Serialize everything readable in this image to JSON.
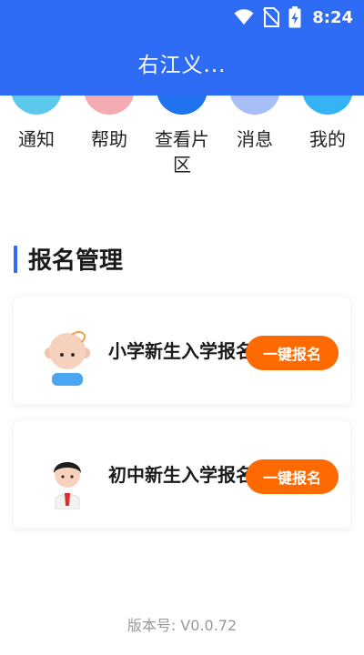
{
  "status_bar": {
    "time": "8:24",
    "icons": [
      "wifi-icon",
      "no-sim-icon",
      "battery-charging-icon"
    ]
  },
  "header": {
    "title": "右江义..."
  },
  "quick_nav": [
    {
      "label": "通知",
      "icon": "notice-icon",
      "color": "#5cc8ee"
    },
    {
      "label": "帮助",
      "icon": "help-icon",
      "color": "#f6aab2"
    },
    {
      "label": "查看片区",
      "icon": "area-icon",
      "color": "#1f73f0"
    },
    {
      "label": "消息",
      "icon": "message-icon",
      "color": "#a9bdf7"
    },
    {
      "label": "我的",
      "icon": "profile-icon",
      "color": "#35b4f5"
    }
  ],
  "section": {
    "title": "报名管理"
  },
  "cards": [
    {
      "title": "小学新生入学报名",
      "button": "一键报名",
      "avatar": "baby-avatar"
    },
    {
      "title": "初中新生入学报名",
      "button": "一键报名",
      "avatar": "student-avatar"
    }
  ],
  "footer": {
    "version": "版本号: V0.0.72"
  },
  "colors": {
    "primary": "#2e6cf6",
    "accent": "#ff6a00"
  }
}
